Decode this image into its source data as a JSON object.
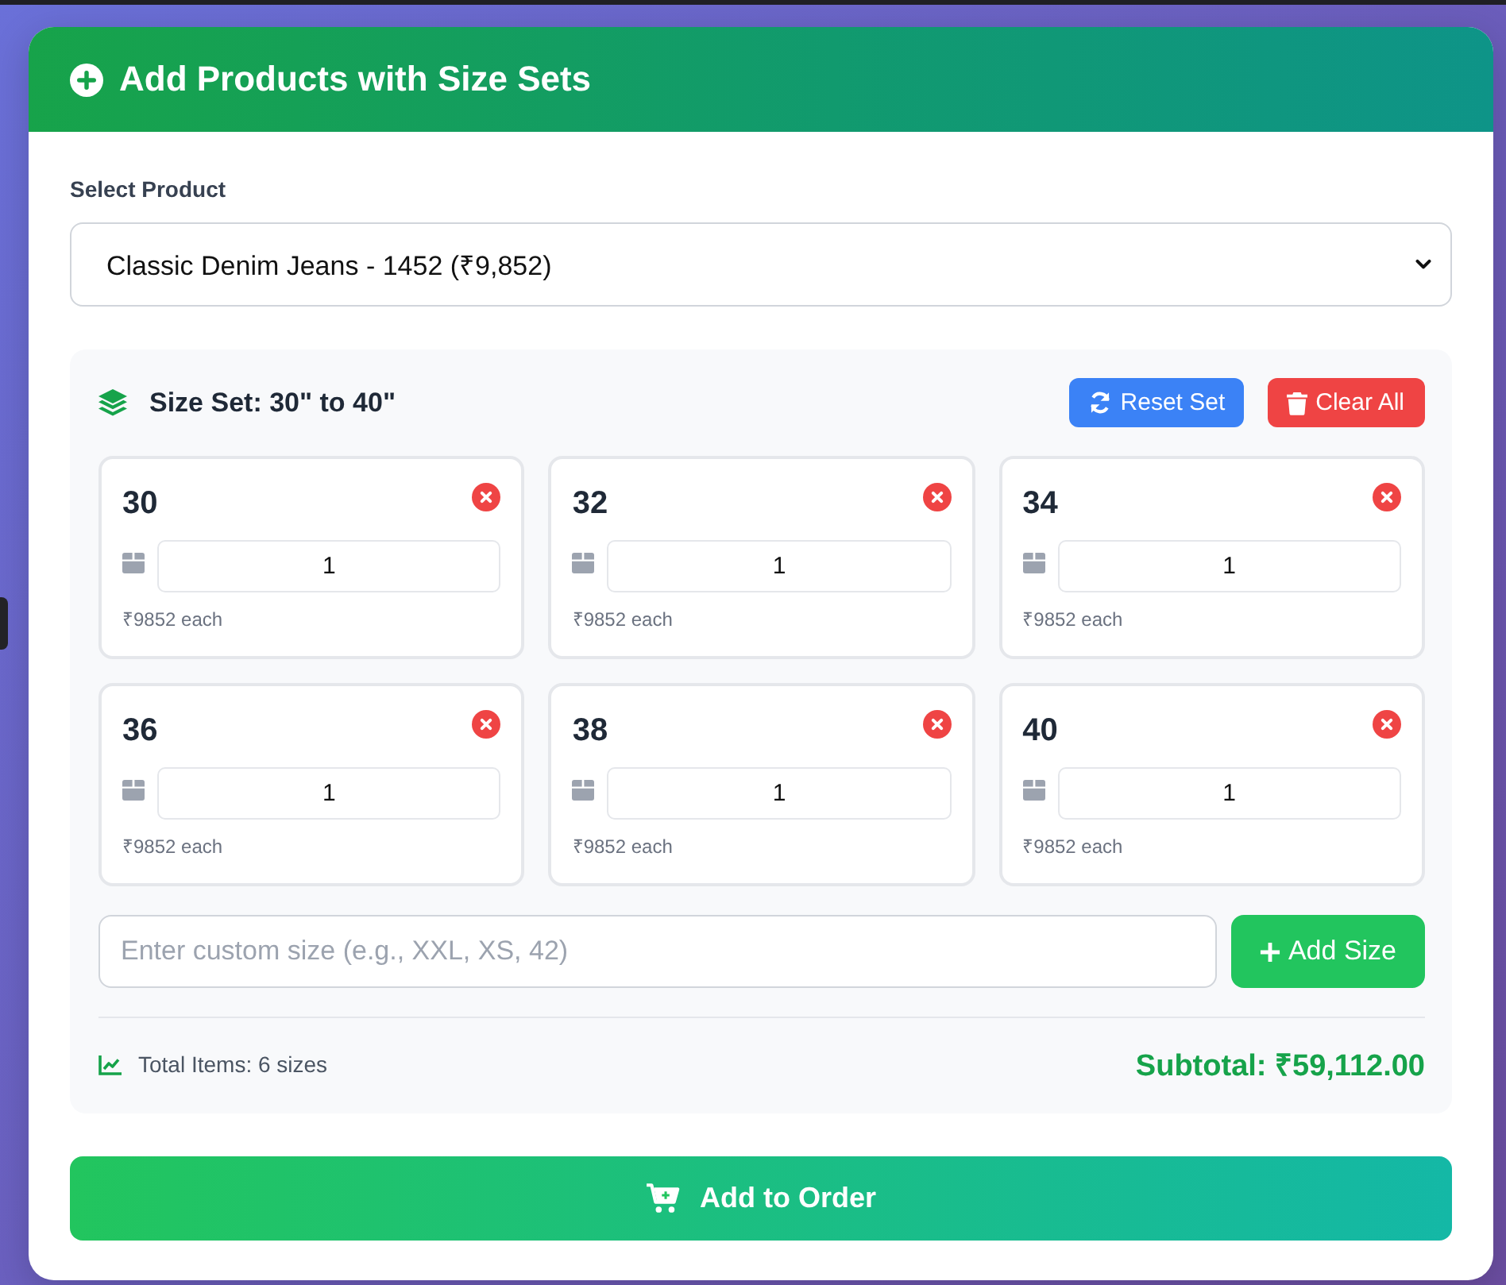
{
  "header": {
    "title": "Add Products with Size Sets"
  },
  "product_select": {
    "label": "Select Product",
    "value": "Classic Denim Jeans - 1452 (₹9,852)"
  },
  "size_set": {
    "title": "Size Set: 30\" to 40\"",
    "buttons": [
      {
        "label": "Reset Set",
        "kind": "reset"
      },
      {
        "label": "Clear All",
        "kind": "clear"
      }
    ],
    "sizes": [
      {
        "size": "30",
        "quantity": "1",
        "price": "₹9852 each"
      },
      {
        "size": "32",
        "quantity": "1",
        "price": "₹9852 each"
      },
      {
        "size": "34",
        "quantity": "1",
        "price": "₹9852 each"
      },
      {
        "size": "36",
        "quantity": "1",
        "price": "₹9852 each"
      },
      {
        "size": "38",
        "quantity": "1",
        "price": "₹9852 each"
      },
      {
        "size": "40",
        "quantity": "1",
        "price": "₹9852 each"
      }
    ],
    "custom_size": {
      "placeholder": "Enter custom size (e.g., XXL, XS, 42)",
      "button": "Add Size"
    },
    "total_items": "Total Items: 6 sizes",
    "subtotal": "Subtotal: ₹59,112.00"
  },
  "submit_button": {
    "label": "Add to Order"
  }
}
